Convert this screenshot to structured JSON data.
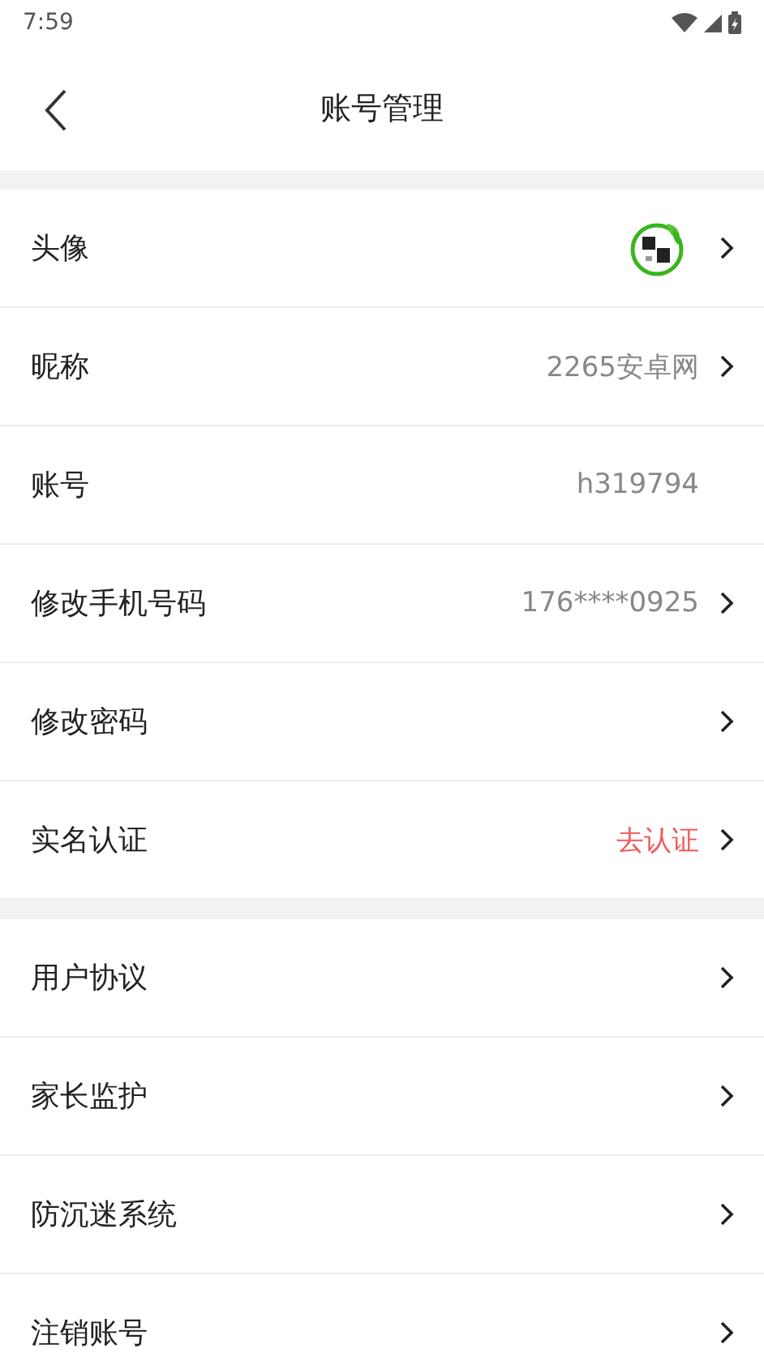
{
  "status_bar": {
    "time": "7:59"
  },
  "header": {
    "title": "账号管理"
  },
  "sections": [
    {
      "rows": [
        {
          "kind": "avatar",
          "label": "头像",
          "chevron": true
        },
        {
          "kind": "text",
          "label": "昵称",
          "value": "2265安卓网",
          "chevron": true,
          "accent": false
        },
        {
          "kind": "text",
          "label": "账号",
          "value": "h319794",
          "chevron": false,
          "accent": false
        },
        {
          "kind": "text",
          "label": "修改手机号码",
          "value": "176****0925",
          "chevron": true,
          "accent": false
        },
        {
          "kind": "text",
          "label": "修改密码",
          "chevron": true
        },
        {
          "kind": "text",
          "label": "实名认证",
          "value": "去认证",
          "chevron": true,
          "accent": true
        }
      ]
    },
    {
      "rows": [
        {
          "kind": "text",
          "label": "用户协议",
          "chevron": true
        },
        {
          "kind": "text",
          "label": "家长监护",
          "chevron": true
        },
        {
          "kind": "text",
          "label": "防沉迷系统",
          "chevron": true
        },
        {
          "kind": "text",
          "label": "注销账号",
          "chevron": true
        }
      ]
    }
  ]
}
